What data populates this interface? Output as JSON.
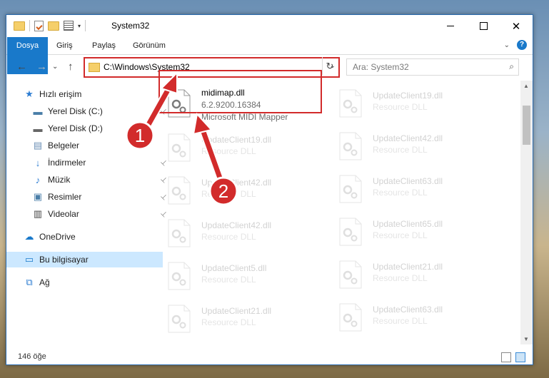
{
  "window": {
    "title": "System32",
    "qat_dropdown": "▾",
    "controls": {
      "minimize": "",
      "maximize": "",
      "close": "✕"
    }
  },
  "ribbon": {
    "tabs": [
      "Dosya",
      "Giriş",
      "Paylaş",
      "Görünüm"
    ],
    "collapse_glyph": "⌄",
    "help": "?"
  },
  "nav": {
    "back": "←",
    "forward": "→",
    "recent": "⌄",
    "up": "↑",
    "address": "C:\\Windows\\System32",
    "address_dropdown": "⌄",
    "refresh": "↻",
    "search_placeholder": "Ara: System32",
    "search_glyph": "⌕"
  },
  "navpane": [
    {
      "label": "Hızlı erişim",
      "icon": "star-icon",
      "glyph": "★",
      "pinned": false,
      "color": "#2d7dd2"
    },
    {
      "label": "Yerel Disk (C:)",
      "icon": "drive-c-icon",
      "glyph": "▬",
      "pinned": true,
      "color": "#4a7ea8"
    },
    {
      "label": "Yerel Disk (D:)",
      "icon": "drive-d-icon",
      "glyph": "▬",
      "pinned": false,
      "color": "#666666"
    },
    {
      "label": "Belgeler",
      "icon": "documents-icon",
      "glyph": "▤",
      "pinned": false,
      "color": "#6b8fb5"
    },
    {
      "label": "İndirmeler",
      "icon": "downloads-icon",
      "glyph": "↓",
      "pinned": true,
      "color": "#2d7dd2"
    },
    {
      "label": "Müzik",
      "icon": "music-icon",
      "glyph": "♪",
      "pinned": true,
      "color": "#2d7dd2"
    },
    {
      "label": "Resimler",
      "icon": "pictures-icon",
      "glyph": "▣",
      "pinned": true,
      "color": "#4a7ea8"
    },
    {
      "label": "Videolar",
      "icon": "videos-icon",
      "glyph": "▥",
      "pinned": true,
      "color": "#444444"
    },
    {
      "label": "OneDrive",
      "icon": "onedrive-icon",
      "glyph": "☁",
      "pinned": false,
      "color": "#1979ca"
    },
    {
      "label": "Bu bilgisayar",
      "icon": "this-pc-icon",
      "glyph": "▭",
      "pinned": false,
      "selected": true,
      "color": "#1979ca"
    },
    {
      "label": "Ağ",
      "icon": "network-icon",
      "glyph": "⧉",
      "pinned": false,
      "color": "#2d7dd2"
    }
  ],
  "pin_glyph": "📌",
  "files": {
    "main": {
      "name": "midimap.dll",
      "version": "6.2.9200.16384",
      "description": "Microsoft MIDI Mapper"
    },
    "left_column": [
      {
        "name": "UpdateClient19.dll",
        "type": "Resource DLL"
      },
      {
        "name": "UpdateClient42.dll",
        "type": "Resource DLL"
      },
      {
        "name": "UpdateClient42.dll",
        "type": "Resource DLL"
      },
      {
        "name": "UpdateClient5.dll",
        "type": "Resource DLL"
      },
      {
        "name": "UpdateClient21.dll",
        "type": "Resource DLL"
      }
    ],
    "right_column": [
      {
        "name": "UpdateClient19.dll",
        "type": "Resource DLL"
      },
      {
        "name": "UpdateClient42.dll",
        "type": "Resource DLL"
      },
      {
        "name": "UpdateClient63.dll",
        "type": "Resource DLL"
      },
      {
        "name": "UpdateClient65.dll",
        "type": "Resource DLL"
      },
      {
        "name": "UpdateClient21.dll",
        "type": "Resource DLL"
      },
      {
        "name": "UpdateClient63.dll",
        "type": "Resource DLL"
      }
    ]
  },
  "annotations": {
    "badge1": "1",
    "badge2": "2",
    "color": "#d22b2b"
  },
  "status": {
    "item_count": "146 öğe"
  },
  "scroll": {
    "up": "▲",
    "down": "▼"
  }
}
